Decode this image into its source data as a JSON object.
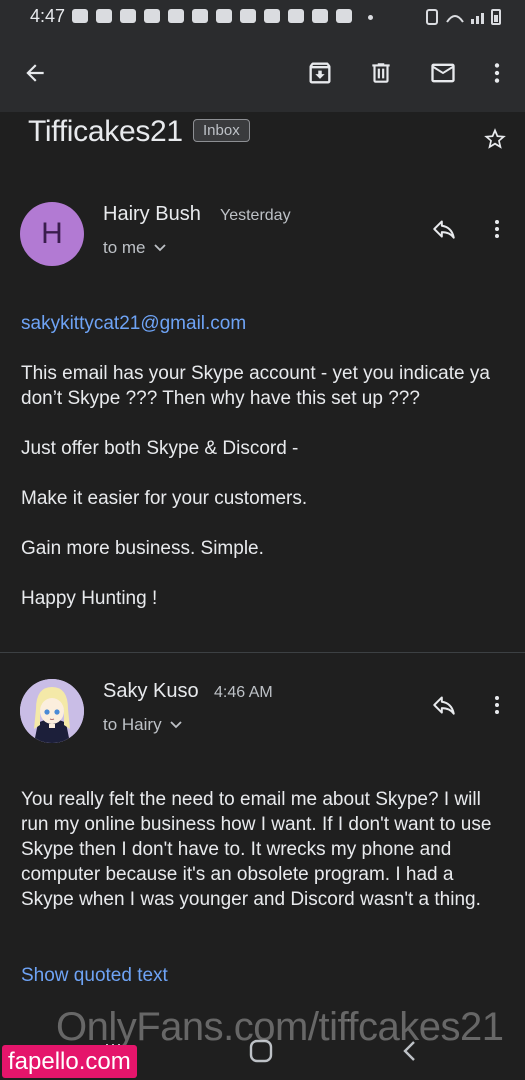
{
  "status_bar": {
    "time": "4:47"
  },
  "app_bar": {
    "back_icon": "arrow-left-icon",
    "archive_icon": "archive-icon",
    "delete_icon": "trash-icon",
    "mark_unread_icon": "envelope-icon",
    "more_icon": "more-vertical-icon"
  },
  "thread": {
    "subject": "Tifficakes21",
    "label": "Inbox"
  },
  "messages": [
    {
      "avatar_letter": "H",
      "sender": "Hairy Bush",
      "time": "Yesterday",
      "recipient": "to me",
      "link": "sakykittycat21@gmail.com",
      "paragraphs": [
        "This email has your Skype account - yet you indicate ya don’t Skype ???  Then why have this set up ???",
        "Just offer both Skype & Discord -",
        "Make it easier for your customers.",
        "Gain more business.  Simple.",
        "Happy Hunting !"
      ]
    },
    {
      "sender": "Saky Kuso",
      "time": "4:46 AM",
      "recipient": "to Hairy",
      "body": "You really felt the need to email me about Skype? I will run my online business how I want. If I don't want to use Skype then I don't have to. It wrecks my phone and computer because it's an obsolete program. I had a Skype when I was younger and Discord wasn't a thing.",
      "show_quoted": "Show quoted text"
    }
  ],
  "overlay": {
    "watermark": "OnlyFans.com/tiffcakes21",
    "badge": "fapello.com"
  },
  "colors": {
    "background": "#1f1f1f",
    "appbar": "#2b2c2e",
    "link": "#6ea3f5",
    "avatar": "#b27ad3"
  }
}
